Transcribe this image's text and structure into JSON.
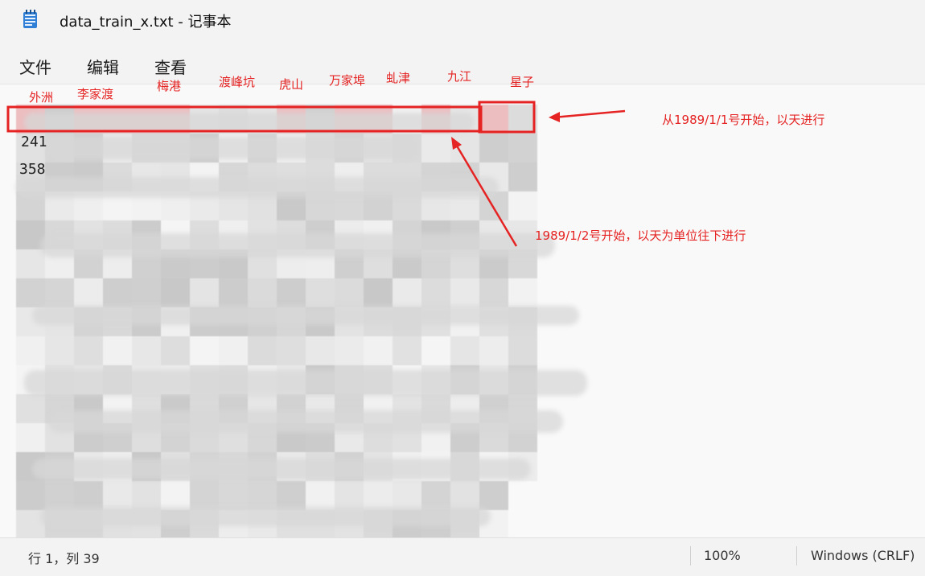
{
  "window": {
    "title": "data_train_x.txt - 记事本",
    "icon": "notepad-icon"
  },
  "menu": {
    "file": "文件",
    "edit": "编辑",
    "view": "查看"
  },
  "annotations": {
    "columns": [
      "外洲",
      "李家渡",
      "梅港",
      "渡峰坑",
      "虎山",
      "万家埠",
      "虬津",
      "九江",
      "星子"
    ],
    "note_row": "从1989/1/1号开始，以天进行",
    "note_column": "1989/1/2号开始，以天为单位往下进行"
  },
  "status": {
    "position": "行 1，列 39",
    "zoom": "100%",
    "line_ending": "Windows (CRLF)"
  },
  "colors": {
    "annotation_red": "#e52323"
  }
}
